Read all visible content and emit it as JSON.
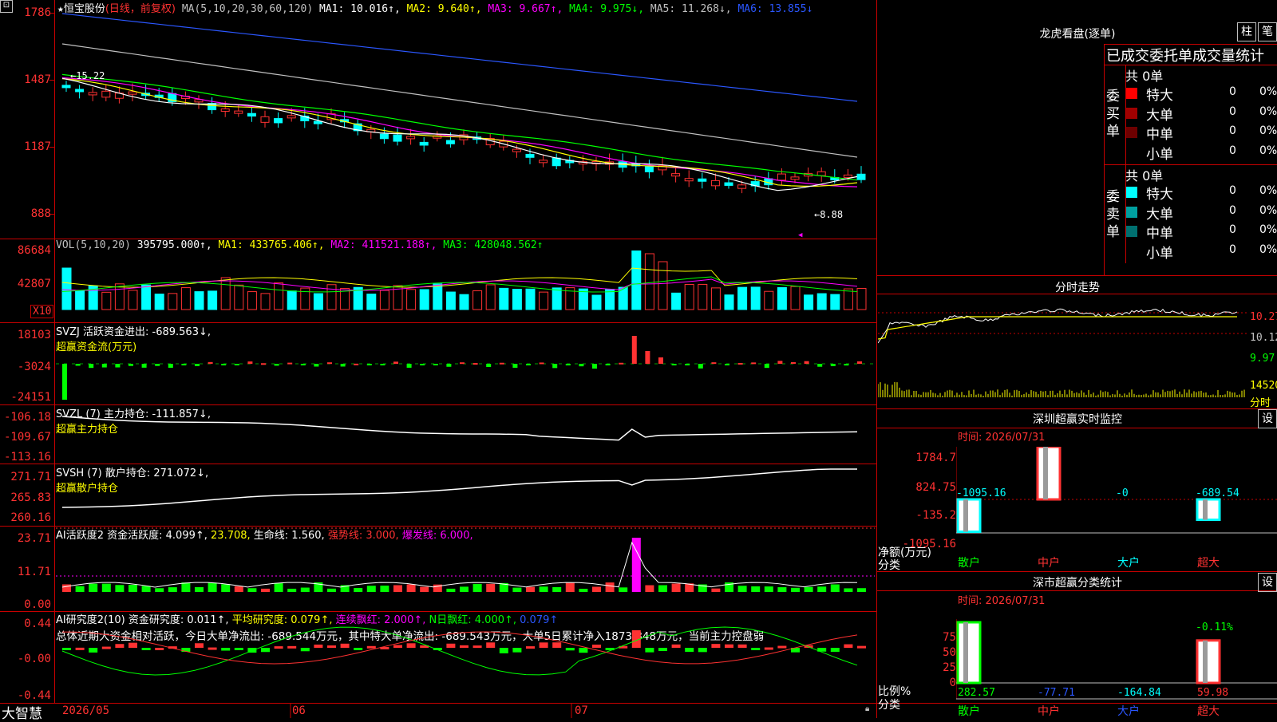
{
  "app": {
    "name": "大智慧",
    "corner_icon": "app-menu-icon"
  },
  "main": {
    "header": {
      "star": "★",
      "stock": "恒宝股份",
      "period": "(日线，前复权)",
      "ma_prefix": "MA(5,10,20,30,60,120)",
      "ma1": "MA1: 10.016↑,",
      "ma2": "MA2: 9.640↑,",
      "ma3": "MA3: 9.667↑,",
      "ma4": "MA4: 9.975↓,",
      "ma5": "MA5: 11.268↓,",
      "ma6": "MA6: 13.855↓"
    },
    "yticks": [
      "1786",
      "1487",
      "1187",
      "888"
    ],
    "high_label": "←15.22",
    "low_label": "←8.88"
  },
  "vol": {
    "header": {
      "prefix": "VOL(5,10,20)",
      "value": "395795.000↑,",
      "ma1": "MA1: 433765.406↑,",
      "ma2": "MA2: 411521.188↑,",
      "ma3": "MA3: 428048.562↑"
    },
    "yticks": [
      "86684",
      "42807"
    ],
    "unit": "X10"
  },
  "svzj": {
    "line1": "SVZJ  活跃资金进出: -689.563↓,",
    "line2": "超赢资金流(万元)",
    "yticks": [
      "18103",
      "-3024",
      "-24151"
    ]
  },
  "svzl": {
    "line1": "SVZL (7) 主力持仓: -111.857↓,",
    "line2": "超赢主力持仓",
    "yticks": [
      "-106.18",
      "-109.67",
      "-113.16"
    ]
  },
  "svsh": {
    "line1": "SVSH (7) 散户持仓: 271.072↓,",
    "line2": "超赢散户持仓",
    "yticks": [
      "271.71",
      "265.83",
      "260.16"
    ]
  },
  "ai_active": {
    "prefix": "AI活跃度2 资金活跃度: 4.099↑,",
    "v2": "23.708,",
    "v3": "生命线: 1.560,",
    "v4": "强势线: 3.000,",
    "v5": "爆发线: 6.000,",
    "yticks": [
      "23.71",
      "11.71",
      "0.00"
    ]
  },
  "ai_research": {
    "prefix": "AI研究度2(10) 资金研究度: 0.011↑,",
    "v2": "平均研究度: 0.079↑,",
    "v3": "连续飘红: 2.000↑,",
    "v4": "N日飘红: 4.000↑,",
    "v5": "0.079↑",
    "summary": "总体近期大资金相对活跃，今日大单净流出: -689.544万元，其中特大单净流出: -689.543万元，大单5日累计净入1873.848万元，当前主力控盘弱",
    "yticks": [
      "0.44",
      "-0.00",
      "-0.44"
    ]
  },
  "xaxis": {
    "labels": [
      "2026/05",
      "06",
      "07"
    ]
  },
  "right": {
    "dragon": {
      "title": "龙虎看盘(逐单)",
      "btn1": "柱",
      "btn2": "笔",
      "subtitle": "已成交委托单成交量统计",
      "buy_label": "委买单",
      "buy_total": "共 0单",
      "sell_label": "委卖单",
      "sell_total": "共 0单",
      "buy_rows": [
        {
          "name": "特大",
          "count": "0",
          "pct": "0%",
          "color": "#ff0000"
        },
        {
          "name": "大单",
          "count": "0",
          "pct": "0%",
          "color": "#a00000"
        },
        {
          "name": "中单",
          "count": "0",
          "pct": "0%",
          "color": "#6e0000"
        },
        {
          "name": "小单",
          "count": "0",
          "pct": "0%",
          "color": "#000000"
        }
      ],
      "sell_rows": [
        {
          "name": "特大",
          "count": "0",
          "pct": "0%",
          "color": "#00ffff"
        },
        {
          "name": "大单",
          "count": "0",
          "pct": "0%",
          "color": "#00a0a0"
        },
        {
          "name": "中单",
          "count": "0",
          "pct": "0%",
          "color": "#007070"
        },
        {
          "name": "小单",
          "count": "0",
          "pct": "0%",
          "color": "#000000"
        }
      ]
    },
    "intraday": {
      "title": "分时走势",
      "y_labels": [
        "10.27",
        "10.12",
        "9.97",
        "14520",
        "分时"
      ]
    },
    "monitor": {
      "title": "深圳超赢实时监控",
      "btn": "设",
      "time": "时间: 2026/07/31",
      "yticks": [
        "1784.7",
        "824.75",
        "-135.2",
        "-1095.16"
      ],
      "axis_title": "净额(万元)",
      "axis_sub": "分类",
      "bars": [
        {
          "category": "散户",
          "value": -1095.16,
          "label": "-1095.16"
        },
        {
          "category": "中户",
          "value": 1784.7,
          "label": "1784.7"
        },
        {
          "category": "大户",
          "value": -0.0,
          "label": "-0"
        },
        {
          "category": "超大",
          "value": -689.54,
          "label": "-689.54"
        }
      ]
    },
    "stats": {
      "title": "深市超赢分类统计",
      "btn": "设",
      "time": "时间: 2026/07/31",
      "yticks": [
        "75",
        "50",
        "25",
        "0"
      ],
      "axis_title": "比例%",
      "axis_sub": "分类",
      "top_label": "-0.11%",
      "bars": [
        {
          "category": "散户",
          "value": 282.57,
          "label": "282.57",
          "pct": 100
        },
        {
          "category": "中户",
          "value": -77.71,
          "label": "-77.71",
          "pct": 0
        },
        {
          "category": "大户",
          "value": -164.84,
          "label": "-164.84",
          "pct": 0
        },
        {
          "category": "超大",
          "value": 59.98,
          "label": "59.98",
          "pct": 70
        }
      ]
    }
  },
  "colors": {
    "up": "#ff3232",
    "down": "#00ffff",
    "frame": "#c80000",
    "ma1": "#ffffff",
    "ma2": "#ffff00",
    "ma3": "#ff00ff",
    "ma4": "#00ff00",
    "ma5": "#c0c0c0",
    "ma6": "#2b57ff"
  }
}
